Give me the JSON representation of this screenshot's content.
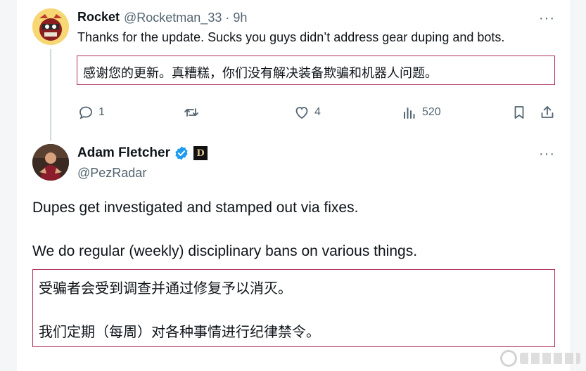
{
  "tweet1": {
    "name": "Rocket",
    "handle": "@Rocketman_33 · 9h",
    "text": "Thanks for the update. Sucks you guys didn’t address gear duping and bots.",
    "translation": "感谢您的更新。真糟糕，你们没有解决装备欺骗和机器人问题。",
    "more": "···",
    "actions": {
      "reply_count": "1",
      "retweet_count": "",
      "like_count": "4",
      "views_count": "520"
    }
  },
  "tweet2": {
    "name": "Adam Fletcher",
    "handle": "@PezRadar",
    "badge_letter": "D",
    "more": "···",
    "paragraph1": "Dupes get investigated and stamped out via fixes.",
    "paragraph2": "We do regular (weekly) disciplinary bans on various things.",
    "translation_line1": "受骗者会受到调查并通过修复予以消灭。",
    "translation_line2": "我们定期（每周）对各种事情进行纪律禁令。"
  },
  "colors": {
    "accent_border": "#b0315b",
    "verified_blue": "#1d9bf0",
    "muted": "#536471"
  }
}
